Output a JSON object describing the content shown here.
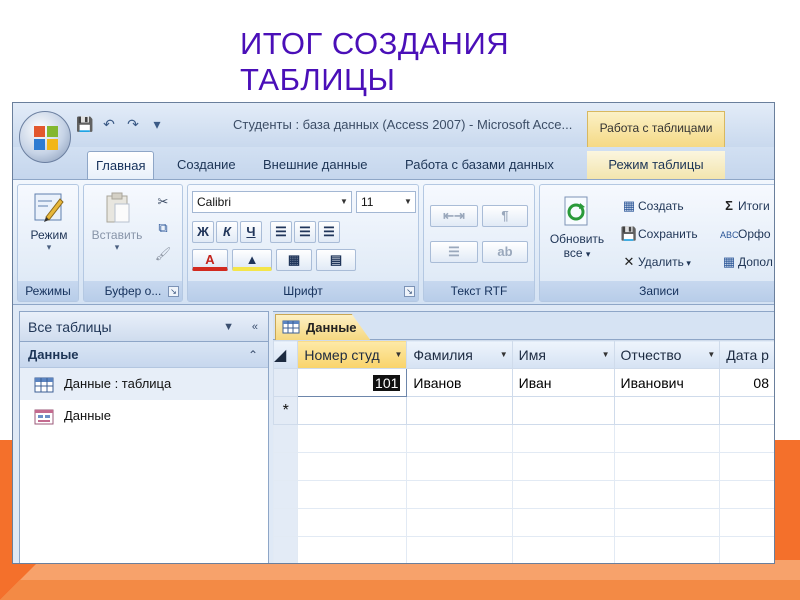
{
  "slide": {
    "title_line1": "ИТОГ СОЗДАНИЯ",
    "title_line2": "ТАБЛИЦЫ"
  },
  "window": {
    "title": "Студенты : база данных (Access 2007) - Microsoft Acce...",
    "context_tab_title": "Работа с таблицами"
  },
  "ribbon_tabs": [
    {
      "label": "Главная",
      "active": true
    },
    {
      "label": "Создание"
    },
    {
      "label": "Внешние данные"
    },
    {
      "label": "Работа с базами данных"
    },
    {
      "label": "Режим таблицы",
      "contextual": true
    }
  ],
  "ribbon": {
    "groups": {
      "views": {
        "label": "Режимы",
        "button": "Режим"
      },
      "clipboard": {
        "label": "Буфер о...",
        "button": "Вставить"
      },
      "font": {
        "label": "Шрифт",
        "font_name": "Calibri",
        "font_size": "11",
        "bold": "Ж",
        "italic": "К",
        "underline": "Ч",
        "font_color_letter": "A"
      },
      "rtf": {
        "label": "Текст RTF"
      },
      "records": {
        "label": "Записи",
        "refresh_line1": "Обновить",
        "refresh_line2": "все",
        "create": "Создать",
        "save": "Сохранить",
        "delete": "Удалить",
        "totals": "Итоги",
        "spelling": "Орфо",
        "more": "Допол"
      }
    }
  },
  "nav_pane": {
    "header": "Все таблицы",
    "group": "Данные",
    "items": [
      {
        "label": "Данные : таблица",
        "icon": "table-icon",
        "selected": true
      },
      {
        "label": "Данные",
        "icon": "form-icon"
      }
    ]
  },
  "document": {
    "tab_label": "Данные",
    "columns": [
      "Номер студ",
      "Фамилия",
      "Имя",
      "Отчество",
      "Дата р"
    ],
    "rows": [
      [
        "101",
        "Иванов",
        "Иван",
        "Иванович",
        "08"
      ]
    ],
    "new_row_marker": "*"
  },
  "colors": {
    "title_purple": "#4a0fb8",
    "slide_orange": "#f4702b",
    "ribbon_blue": "#dfe9f6",
    "context_gold": "#f5d985"
  }
}
